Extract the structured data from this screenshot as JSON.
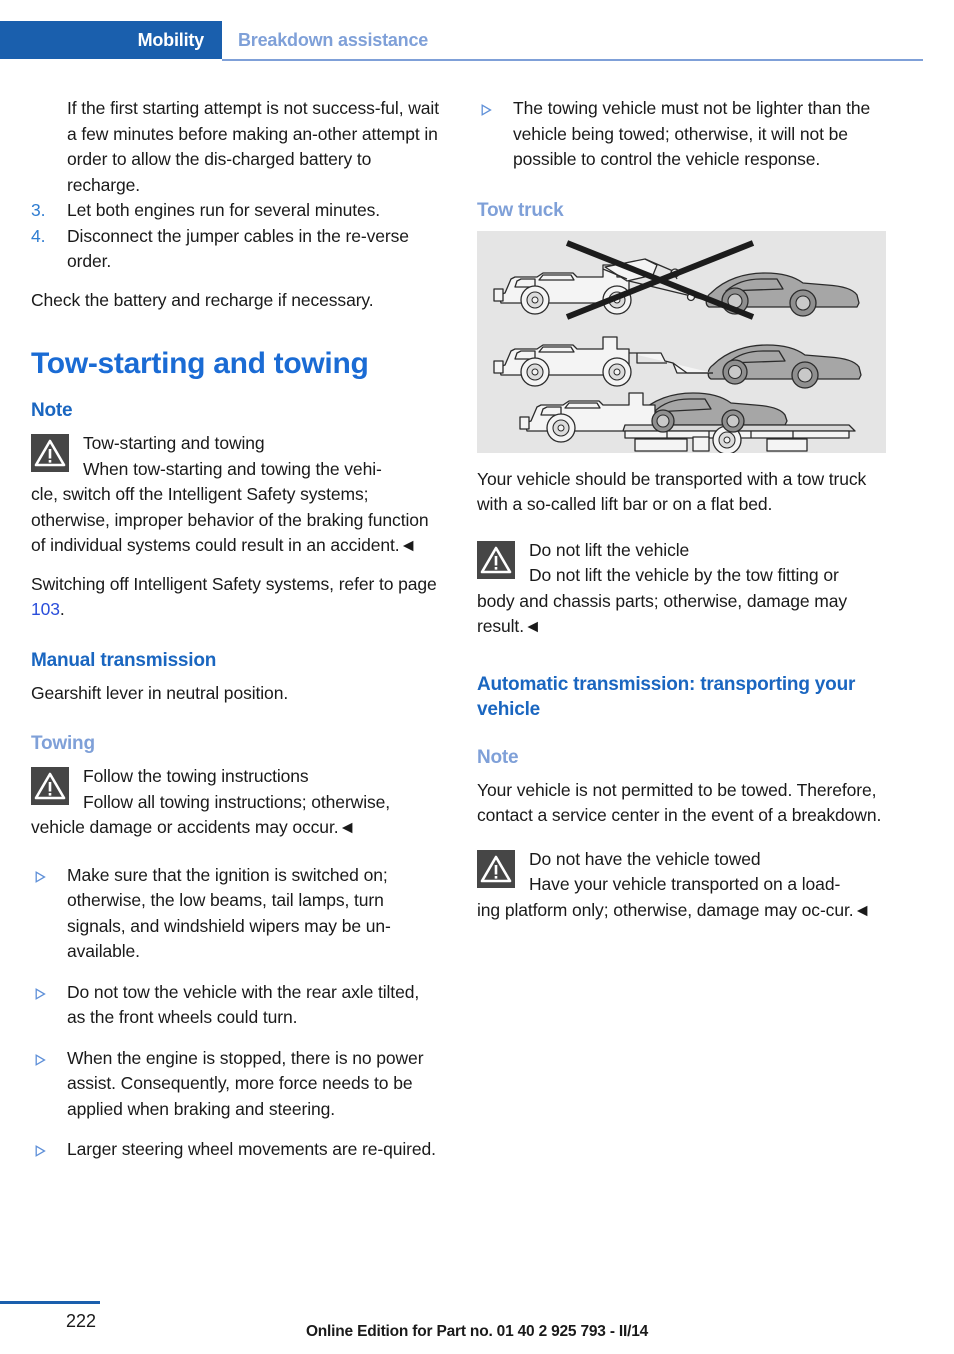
{
  "header": {
    "tab_label": "Mobility",
    "section_label": "Breakdown assistance",
    "tab_bg": "#1a5fad",
    "section_color": "#7fa0d8"
  },
  "left_column": {
    "continued_step_text": "If the first starting attempt is not success-ful, wait a few minutes before making an-other attempt in order to allow the dis-charged battery to recharge.",
    "steps": [
      {
        "number": "3.",
        "text": "Let both engines run for several minutes."
      },
      {
        "number": "4.",
        "text": "Disconnect the jumper cables in the re-verse order."
      }
    ],
    "after_steps_text": "Check the battery and recharge if necessary.",
    "heading_main": "Tow-starting and towing",
    "note_heading": "Note",
    "warning_1": {
      "icon": "warning-triangle-icon",
      "title": "Tow-starting and towing",
      "body": "When tow-starting and towing the vehi-",
      "body_rest": "cle, switch off the Intelligent Safety systems; otherwise, improper behavior of the braking function of individual systems could result in an accident.",
      "endmark": "◄"
    },
    "reference_text_before": "Switching off Intelligent Safety systems, refer to page ",
    "reference_page": "103",
    "reference_text_after": ".",
    "heading_manual": "Manual transmission",
    "manual_text": "Gearshift lever in neutral position.",
    "heading_towing": "Towing",
    "warning_2": {
      "icon": "warning-triangle-icon",
      "title": "Follow the towing instructions",
      "body": "Follow all towing instructions; otherwise,",
      "body_rest": "vehicle damage or accidents may occur.",
      "endmark": "◄"
    },
    "bullets": [
      "Make sure that the ignition is switched on; otherwise, the low beams, tail lamps, turn signals, and windshield wipers may be un-available.",
      "Do not tow the vehicle with the rear axle tilted, as the front wheels could turn.",
      "When the engine is stopped, there is no power assist. Consequently, more force needs to be applied when braking and steering.",
      "Larger steering wheel movements are re-quired."
    ]
  },
  "right_column": {
    "bullets_top": [
      "The towing vehicle must not be lighter than the vehicle being towed; otherwise, it will not be possible to control the vehicle response."
    ],
    "heading_tow_truck": "Tow truck",
    "illustration_alt": "tow-truck-illustration",
    "tow_truck_text": "Your vehicle should be transported with a tow truck with a so-called lift bar or on a flat bed.",
    "warning_1": {
      "icon": "warning-triangle-icon",
      "title": "Do not lift the vehicle",
      "body": "Do not lift the vehicle by the tow fitting or",
      "body_rest": "body and chassis parts; otherwise, damage may result.",
      "endmark": "◄"
    },
    "heading_automatic": "Automatic transmission: transporting your vehicle",
    "note_heading": "Note",
    "note_text": "Your vehicle is not permitted to be towed. Therefore, contact a service center in the event of a breakdown.",
    "warning_2": {
      "icon": "warning-triangle-icon",
      "title": "Do not have the vehicle towed",
      "body": "Have your vehicle transported on a load-",
      "body_rest": "ing platform only; otherwise, damage may oc-cur.",
      "endmark": "◄"
    }
  },
  "footer": {
    "page_number": "222",
    "note": "Online Edition for Part no. 01 40 2 925 793 - II/14",
    "bar_color": "#1a5fad"
  },
  "colors": {
    "accent_blue": "#1a6bd4",
    "heading_blue": "#1a66c0",
    "light_blue": "#7fa0d8",
    "link_blue": "#2a4edb",
    "warn_icon_bg": "#464646",
    "illustration_bg": "#e5e5e5"
  }
}
